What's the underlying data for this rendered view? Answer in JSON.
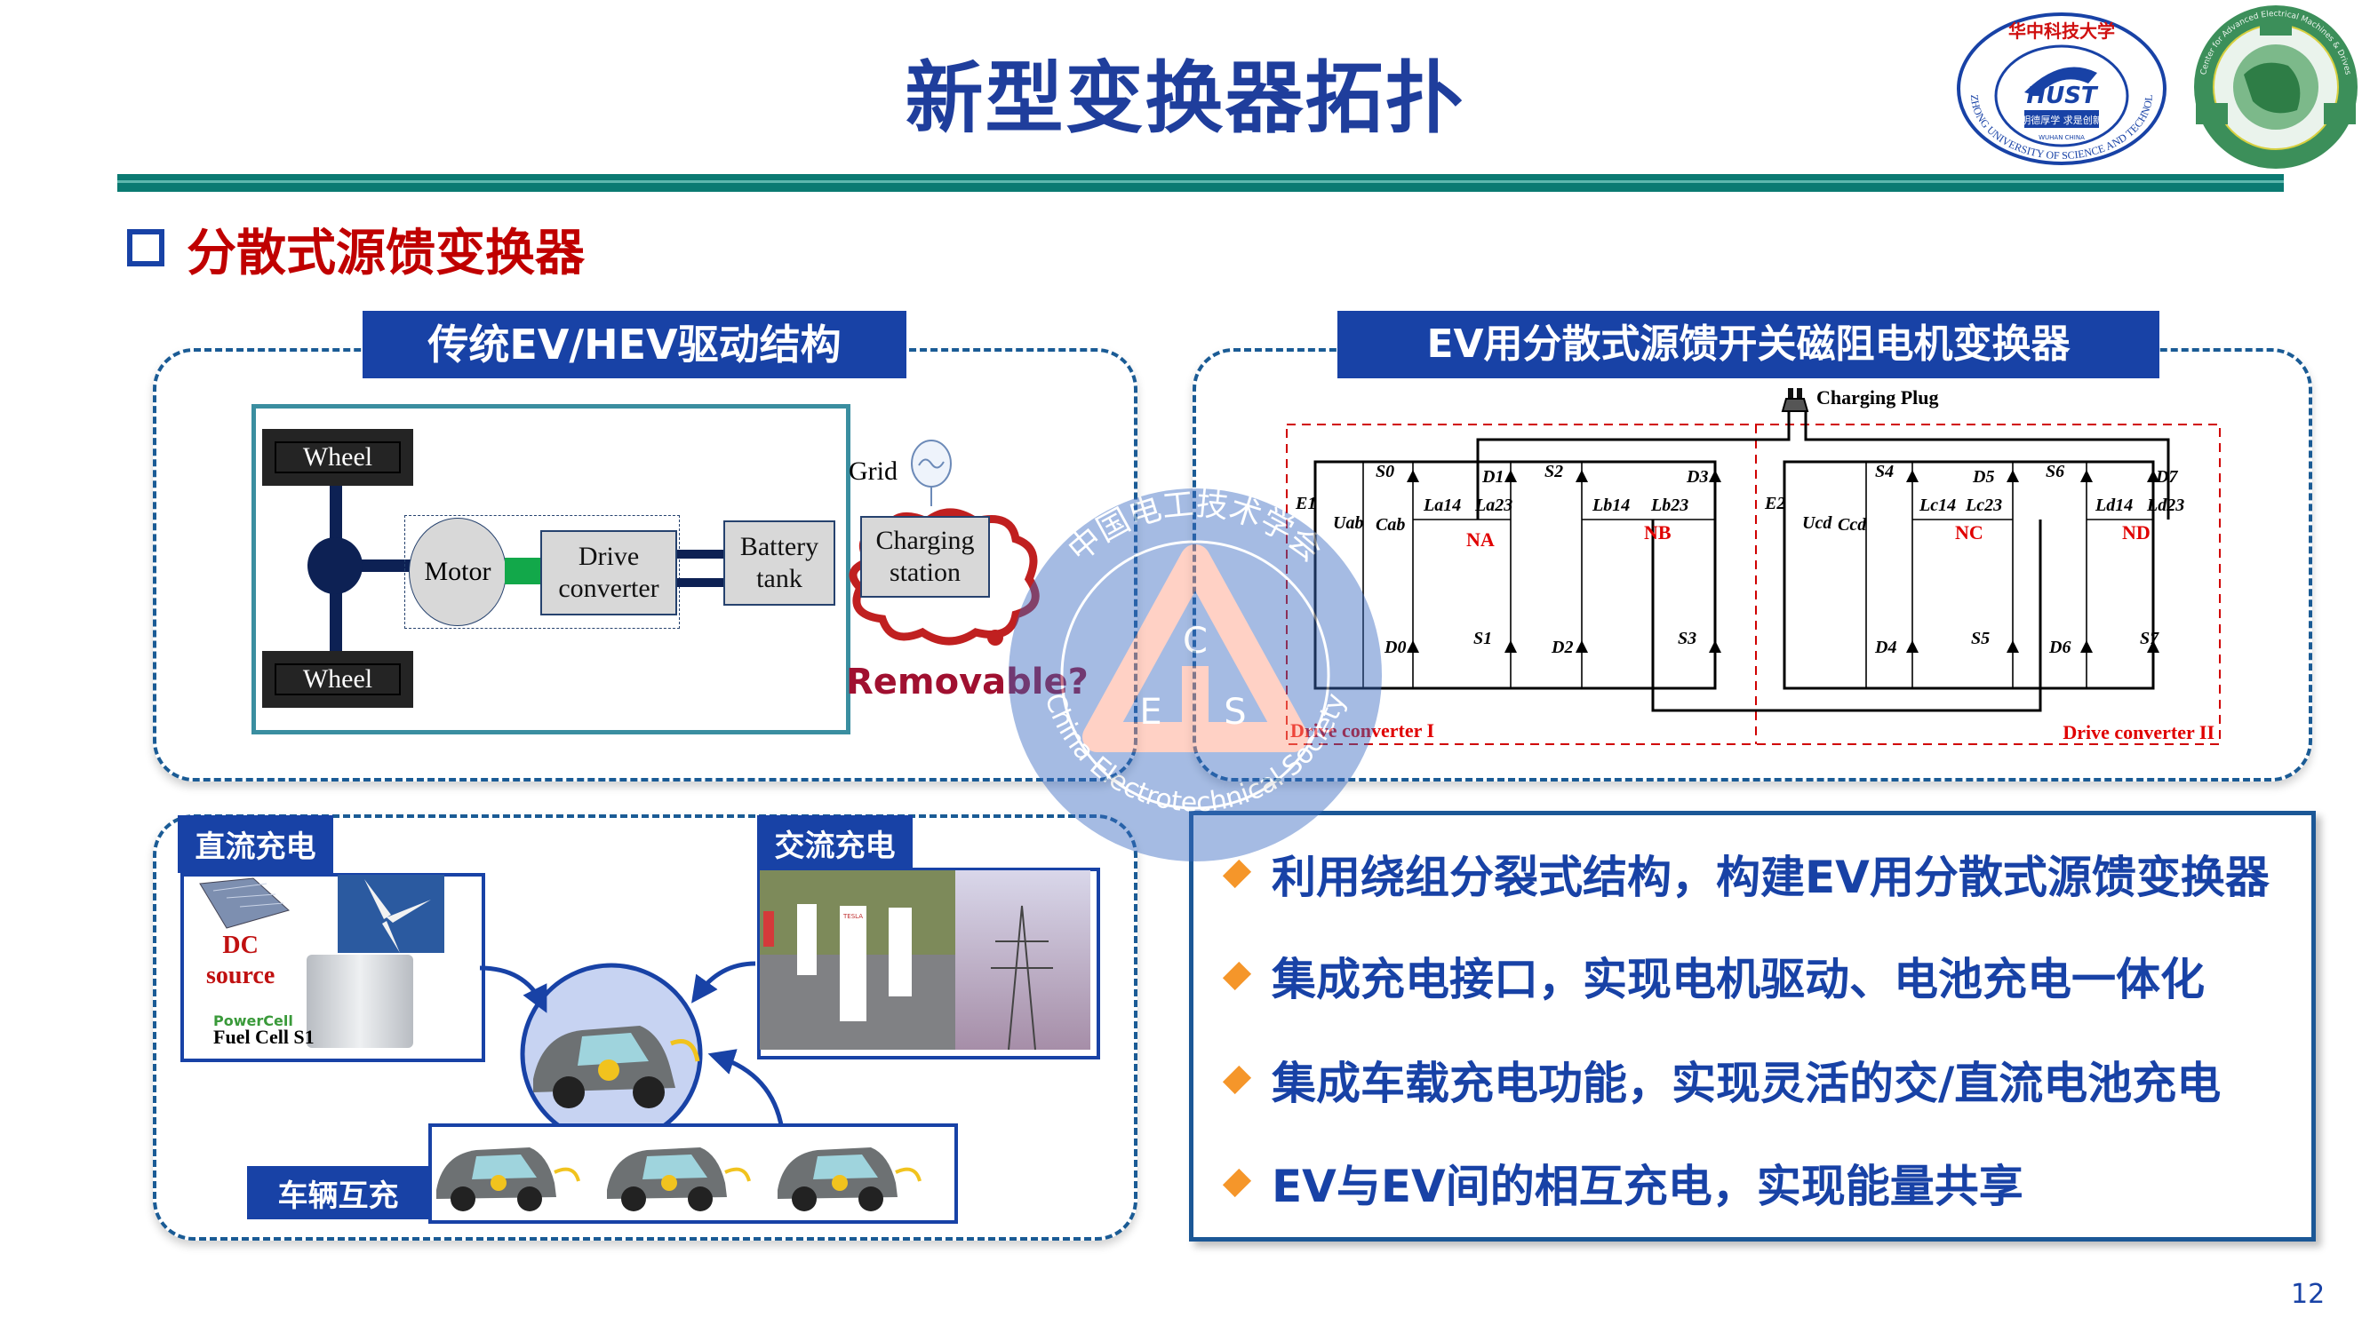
{
  "slide": {
    "title": "新型变换器拓扑",
    "section_title": "分散式源馈变换器",
    "page_number": "12"
  },
  "logos": {
    "hust": {
      "top_text": "华中科技大学",
      "ring_text": "HUAZHONG UNIVERSITY OF SCIENCE AND TECHNOLOGY",
      "center": "HUST",
      "motto": "明德厚学 求是创新",
      "city": "WUHAN CHINA"
    },
    "center": {
      "ring_text": "Center for Advanced Electrical Machines & Drives"
    }
  },
  "watermark": {
    "cn": "中国电工技术学会",
    "en": "China Electrotechnical Society",
    "letters": [
      "C",
      "E",
      "S"
    ]
  },
  "panel_traditional": {
    "tag": "传统EV/HEV驱动结构",
    "wheel_top": "Wheel",
    "wheel_bottom": "Wheel",
    "motor": "Motor",
    "drive_converter": [
      "Drive",
      "converter"
    ],
    "battery": [
      "Battery",
      "tank"
    ],
    "grid": "Grid",
    "charging_station": [
      "Charging",
      "station"
    ],
    "question": "Removable?"
  },
  "panel_converter": {
    "tag": "EV用分散式源馈开关磁阻电机变换器",
    "charging_plug": "Charging Plug",
    "converter_1_label": "Drive converter I",
    "converter_2_label": "Drive converter II",
    "converter_1": {
      "source": "E1",
      "voltage": "Uab",
      "cap": "Cab",
      "switches": [
        "S0",
        "S1",
        "S2",
        "S3"
      ],
      "diodes": [
        "D0",
        "D1",
        "D2",
        "D3"
      ],
      "inductors": [
        "La14",
        "La23",
        "Lb14",
        "Lb23"
      ],
      "nodes": [
        "NA",
        "NB"
      ]
    },
    "converter_2": {
      "source": "E2",
      "voltage": "Ucd",
      "cap": "Ccd",
      "switches": [
        "S4",
        "S5",
        "S6",
        "S7"
      ],
      "diodes": [
        "D4",
        "D5",
        "D6",
        "D7"
      ],
      "inductors": [
        "Lc14",
        "Lc23",
        "Ld14",
        "Ld23"
      ],
      "nodes": [
        "NC",
        "ND"
      ]
    }
  },
  "panel_charging": {
    "dc_tag": "直流充电",
    "ac_tag": "交流充电",
    "v2v_tag": "车辆互充",
    "dc_source": [
      "DC",
      "source"
    ],
    "powercell_brand": "PowerCell",
    "fuel_cell": "Fuel Cell S1",
    "tesla_sign": "TESLA"
  },
  "bullets": [
    "利用绕组分裂式结构，构建EV用分散式源馈变换器",
    "集成充电接口，实现电机驱动、电池充电一体化",
    "集成车载充电功能，实现灵活的交/直流电池充电",
    "EV与EV间的相互充电，实现能量共享"
  ],
  "colors": {
    "title_blue": "#1f3e9c",
    "tag_blue": "#1842a6",
    "section_red": "#c00000",
    "rule_teal": "#0b7a72",
    "bullet_orange": "#f5962a",
    "label_red": "#e00000",
    "dark_red": "#a01030"
  }
}
